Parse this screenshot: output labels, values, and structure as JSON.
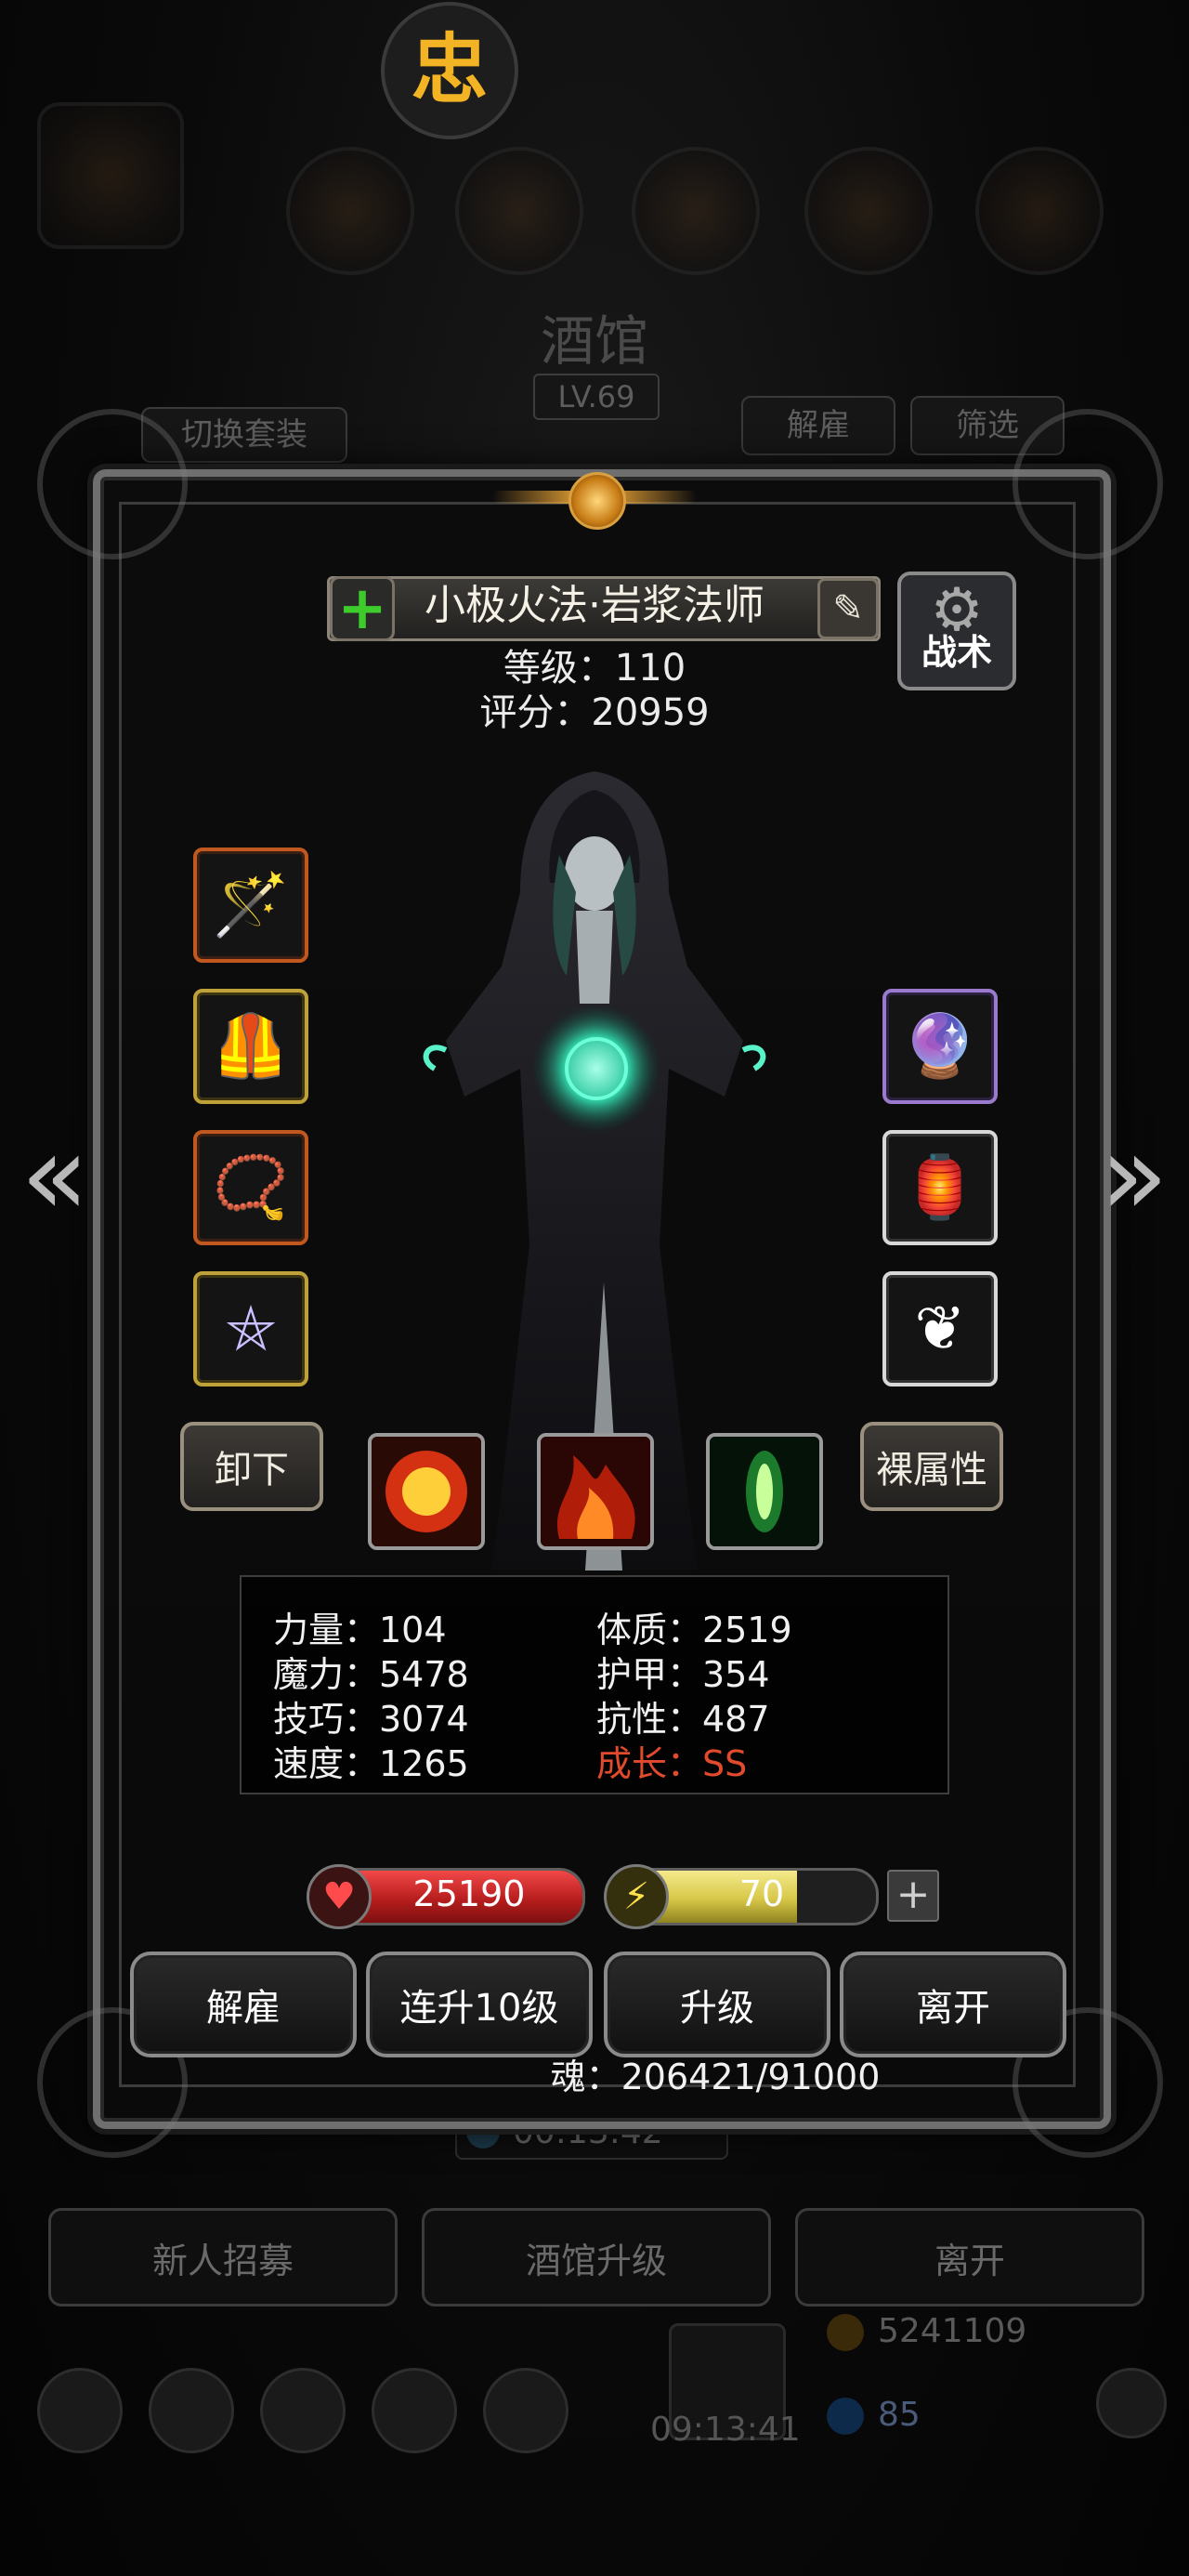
{
  "logo": {
    "glyph": "忠"
  },
  "background": {
    "title": "酒馆",
    "level": "LV.69",
    "switch_suit_label": "切换套装",
    "dismiss_label": "解雇",
    "filter_label": "筛选",
    "timer": "00:13:42",
    "recruit_label": "新人招募",
    "upgrade_tavern_label": "酒馆升级",
    "leave_label": "离开",
    "gold": "5241109",
    "gems": "85",
    "bottom_timer": "09:13:41"
  },
  "hero": {
    "name": "小极火法·岩浆法师",
    "level_text": "等级：110",
    "score_text": "评分：20959",
    "tactic_label": "战术"
  },
  "equipment": {
    "left": [
      {
        "name": "weapon-slot",
        "icon": "staff-icon",
        "glyph": "🦯",
        "rarity": "orange"
      },
      {
        "name": "armor-slot",
        "icon": "armor-icon",
        "glyph": "🛡",
        "rarity": "gold"
      },
      {
        "name": "necklace-slot",
        "icon": "amulet-icon",
        "glyph": "📿",
        "rarity": "orange"
      },
      {
        "name": "ring-slot",
        "icon": "pentagram-icon",
        "glyph": "⛤",
        "rarity": "gold"
      }
    ],
    "right": [
      {
        "name": "orb-slot",
        "icon": "orb-icon",
        "glyph": "🔮",
        "rarity": "purple"
      },
      {
        "name": "lantern-slot",
        "icon": "lantern-icon",
        "glyph": "🏮",
        "rarity": "white"
      },
      {
        "name": "wing-slot",
        "icon": "wing-icon",
        "glyph": "🪽",
        "rarity": "white"
      }
    ]
  },
  "actions": {
    "unequip_label": "卸下",
    "naked_attr_label": "裸属性"
  },
  "skills": [
    {
      "name": "fire-burst-skill",
      "color1": "#ffcf3a",
      "color2": "#d43112"
    },
    {
      "name": "flame-skill",
      "color1": "#ff8a26",
      "color2": "#b01e0a"
    },
    {
      "name": "green-flame-skill",
      "color1": "#c9ff9a",
      "color2": "#1c7a2c"
    }
  ],
  "stats": {
    "str": "力量：104",
    "con": "体质：2519",
    "mag": "魔力：5478",
    "armor": "护甲：354",
    "skill": "技巧：3074",
    "resist": "抗性：487",
    "speed": "速度：1265",
    "growth": "成长：SS"
  },
  "bars": {
    "hp_value": "25190",
    "hp_fill": 1.0,
    "energy_value": "70",
    "energy_fill": 0.7,
    "plus_label": "+"
  },
  "buttons": {
    "dismiss": "解雇",
    "upgrade10": "连升10级",
    "upgrade": "升级",
    "leave": "离开"
  },
  "soul_text": "魂：206421/91000"
}
